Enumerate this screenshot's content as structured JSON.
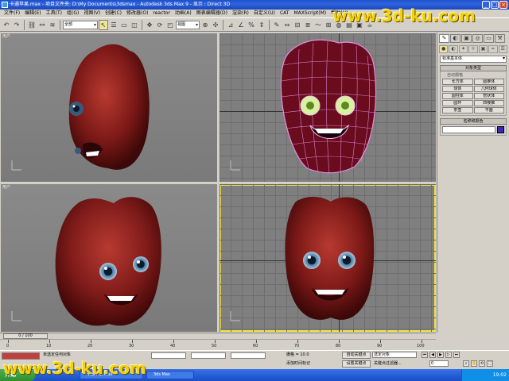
{
  "window": {
    "title": "卡通苹果.max  - 项目文件夹: D:\\My Documents\\3dsmax   - Autodesk 3ds Max 9   - 显示 : Direct 3D",
    "min": "_",
    "max": "□",
    "close": "×"
  },
  "menu": [
    "文件(F)",
    "编辑(E)",
    "工具(T)",
    "组(G)",
    "视图(V)",
    "创建(C)",
    "修改器(O)",
    "reactor",
    "动画(A)",
    "图表编辑器(D)",
    "渲染(R)",
    "自定义(U)",
    "CAT",
    "MAXScript(M)",
    "帮助(H)"
  ],
  "toolbar": {
    "selection_filter": "全部",
    "ref_coord": "视图"
  },
  "viewports": [
    {
      "label": "用户"
    },
    {
      "label": ""
    },
    {
      "label": "用户"
    },
    {
      "label": ""
    }
  ],
  "command_panel": {
    "tabs": [
      "✎",
      "◐",
      "▣",
      "◎",
      "▭",
      "⚒"
    ],
    "icons": [
      "●",
      "◐",
      "✦",
      "☼",
      "▣",
      "≈",
      "☰"
    ],
    "category": "标准基本体",
    "object_type_title": "对象类型",
    "autogrid": "自动栅格",
    "buttons": [
      "长方体",
      "圆锥体",
      "球体",
      "几何球体",
      "圆柱体",
      "管状体",
      "圆环",
      "四棱锥",
      "茶壶",
      "平面"
    ],
    "name_color_title": "名称和颜色"
  },
  "timeline": {
    "frame": "0 / 100",
    "ticks": [
      "0",
      "10",
      "20",
      "30",
      "40",
      "50",
      "60",
      "70",
      "80",
      "90",
      "100"
    ]
  },
  "status": {
    "none_selected": "未选定任何对象",
    "add_time_tag": "添加时间标记",
    "grid": "栅格 = 10.0",
    "auto_key": "自动关键点",
    "set_key": "设置关键点",
    "key_mode": "选定对象",
    "key_filters": "关键点过滤器...",
    "frame_field": "0"
  },
  "taskbar": {
    "start": "开始",
    "items": [
      "卡通苹果.max",
      "3ds Max"
    ],
    "clock": "19:02"
  },
  "watermarks": [
    "www.3d-ku.com",
    "www.3d-ku.com"
  ],
  "colors": {
    "apple": "#8a1c1a",
    "wire": "#e080e0",
    "active_border": "#f0e040",
    "object_color": "#3b2ab8"
  }
}
